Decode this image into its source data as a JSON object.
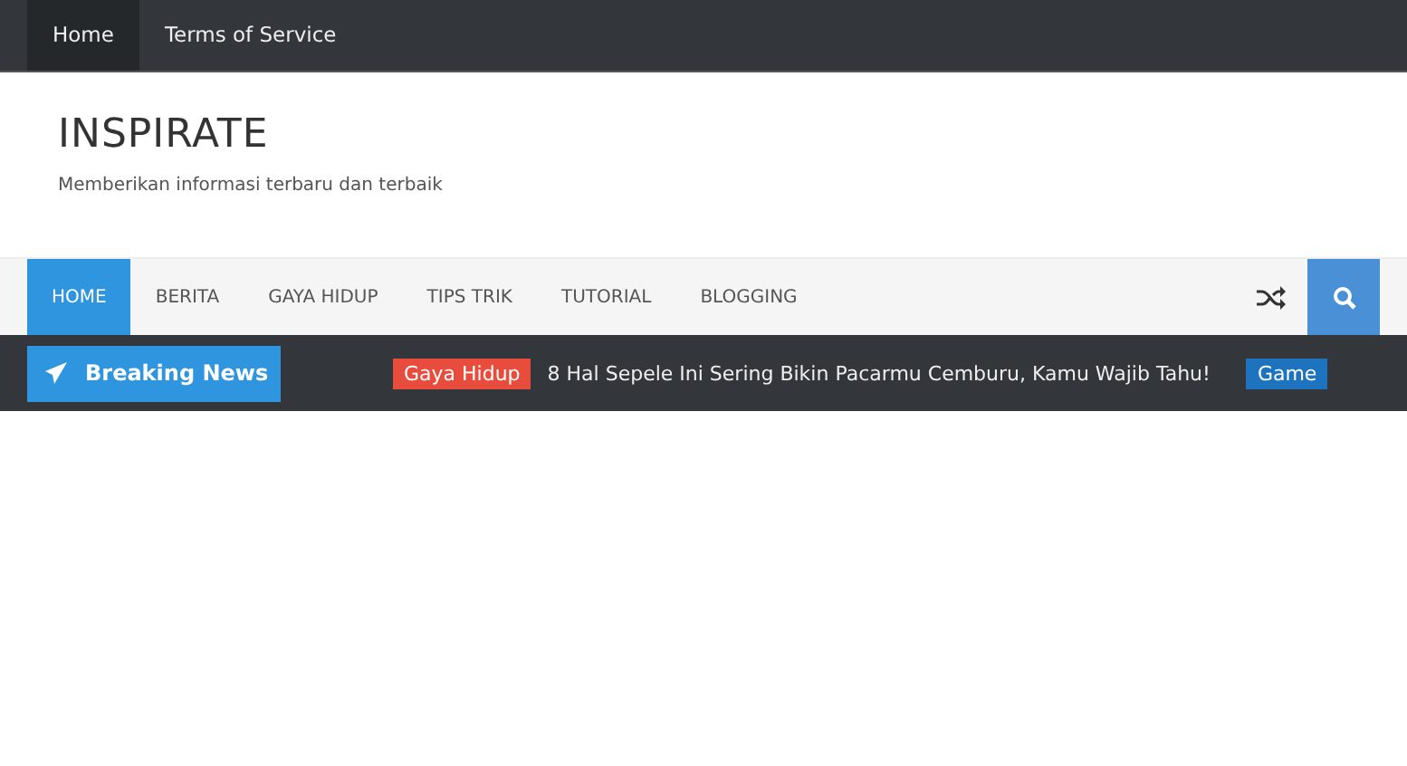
{
  "top_menu": [
    {
      "label": "Home",
      "selected": true
    },
    {
      "label": "Terms of Service",
      "selected": false
    }
  ],
  "header": {
    "title": "INSPIRATE",
    "tagline": "Memberikan informasi terbaru dan terbaik"
  },
  "main_menu": [
    {
      "label": "HOME",
      "selected": true
    },
    {
      "label": "BERITA",
      "selected": false
    },
    {
      "label": "GAYA HIDUP",
      "selected": false
    },
    {
      "label": "TIPS TRIK",
      "selected": false
    },
    {
      "label": "TUTORIAL",
      "selected": false
    },
    {
      "label": "BLOGGING",
      "selected": false
    }
  ],
  "breaking": {
    "label": "Breaking News",
    "items": [
      {
        "tag": "Gaya Hidup",
        "color": "#e74c3c",
        "title": "8 Hal Sepele Ini Sering Bikin Pacarmu Cemburu, Kamu Wajib Tahu!"
      },
      {
        "tag": "Game",
        "color": "#1e73be"
      }
    ]
  }
}
